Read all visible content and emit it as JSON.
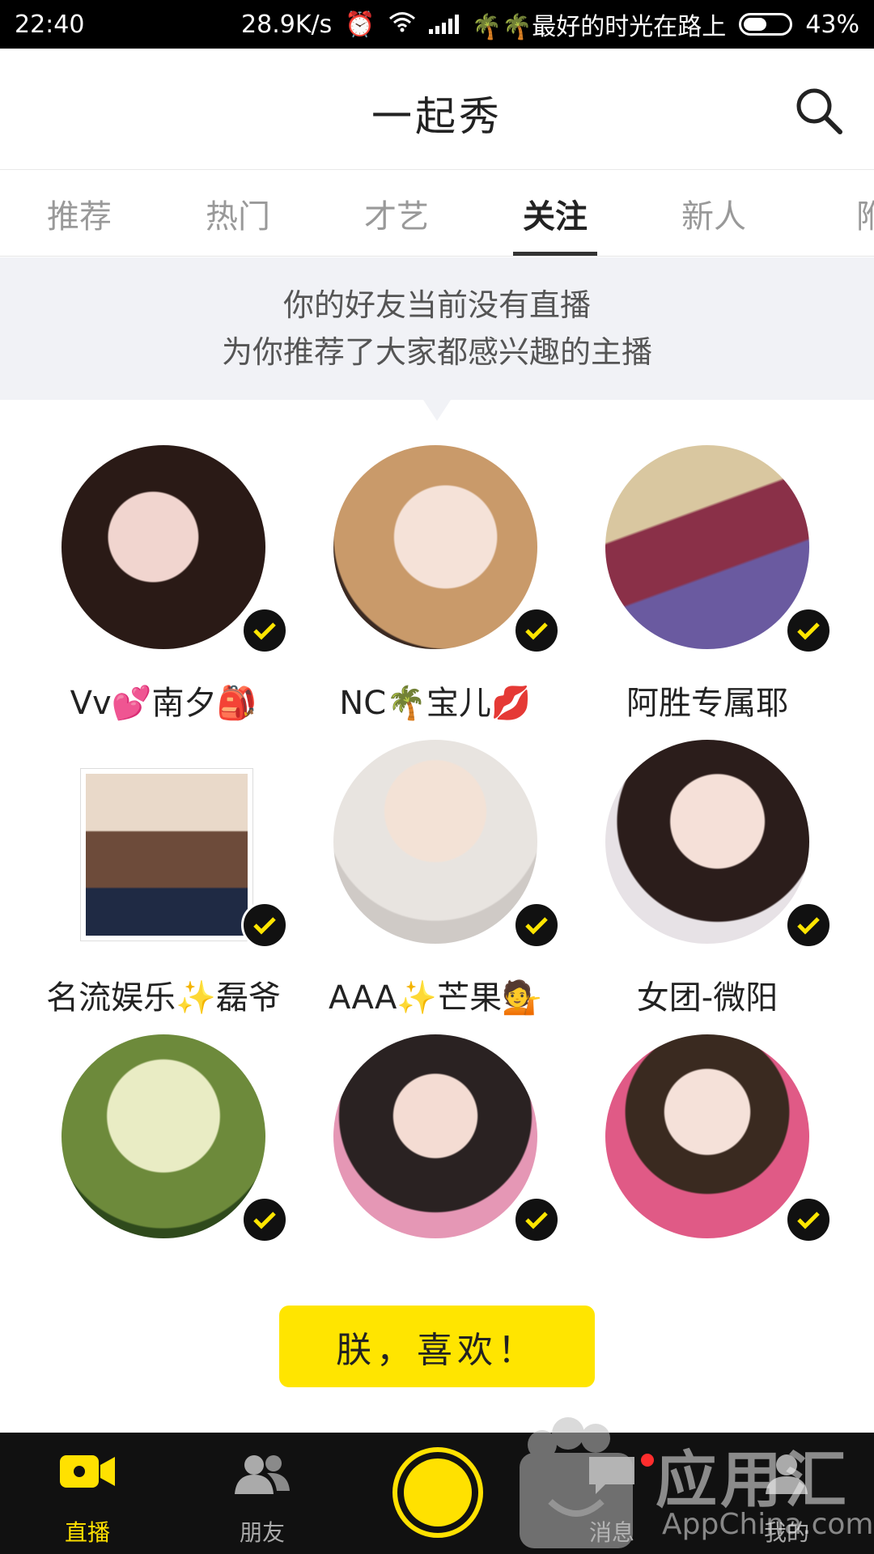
{
  "status_bar": {
    "time": "22:40",
    "net_speed": "28.9K/s",
    "carrier": "🌴🌴最好的时光在路上",
    "battery": "43%"
  },
  "header": {
    "title": "一起秀"
  },
  "tabs": [
    "推荐",
    "热门",
    "才艺",
    "关注",
    "新人",
    "附"
  ],
  "active_tab": "关注",
  "notice": {
    "line1": "你的好友当前没有直播",
    "line2": "为你推荐了大家都感兴趣的主播"
  },
  "streamers": [
    {
      "name": "Vv💕南夕🎒"
    },
    {
      "name": "NC🌴宝儿💋"
    },
    {
      "name": "阿胜专属耶"
    },
    {
      "name": "名流娱乐✨磊爷"
    },
    {
      "name": "AAA✨芒果💁"
    },
    {
      "name": "女团-微阳"
    },
    {
      "name": ""
    },
    {
      "name": ""
    },
    {
      "name": ""
    }
  ],
  "cta": {
    "label": "朕，喜欢！"
  },
  "bottom_nav": [
    {
      "label": "直播",
      "icon": "video-camera-icon"
    },
    {
      "label": "朋友",
      "icon": "friends-icon"
    },
    {
      "label": "",
      "icon": "record-icon"
    },
    {
      "label": "消息",
      "icon": "message-icon"
    },
    {
      "label": "我的",
      "icon": "profile-icon"
    }
  ],
  "watermark": {
    "text": "应用汇",
    "sub": "AppChina.com"
  },
  "colors": {
    "accent": "#ffe500",
    "nav_bg": "#111111"
  }
}
